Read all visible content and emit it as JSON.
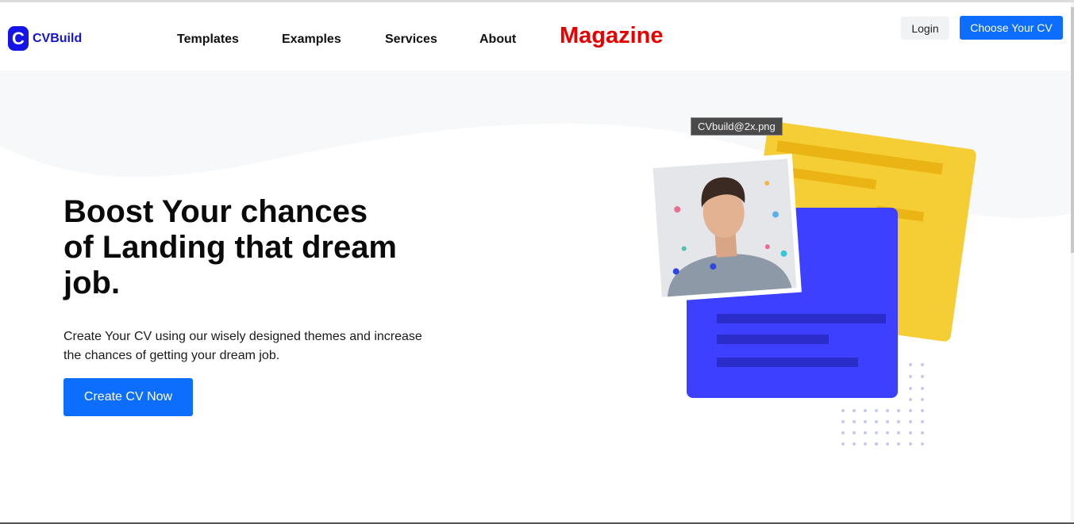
{
  "brand": {
    "letter": "C",
    "name": "CVBuild",
    "color": "#1414e6"
  },
  "nav": {
    "templates": "Templates",
    "examples": "Examples",
    "services": "Services",
    "about": "About",
    "magazine": "Magazine"
  },
  "header_actions": {
    "login": "Login",
    "choose": "Choose Your CV"
  },
  "hero": {
    "headline": "Boost Your chances of Landing that dream job.",
    "lead": "Create Your CV using our wisely designed themes and increase the chances of getting your dream job.",
    "cta": "Create CV Now"
  },
  "illustration": {
    "tooltip": "CVbuild@2x.png"
  },
  "colors": {
    "primary": "#0d6efd",
    "magazine": "#e80000",
    "card_yellow": "#f5cd35",
    "card_blue": "#3d40ff"
  }
}
